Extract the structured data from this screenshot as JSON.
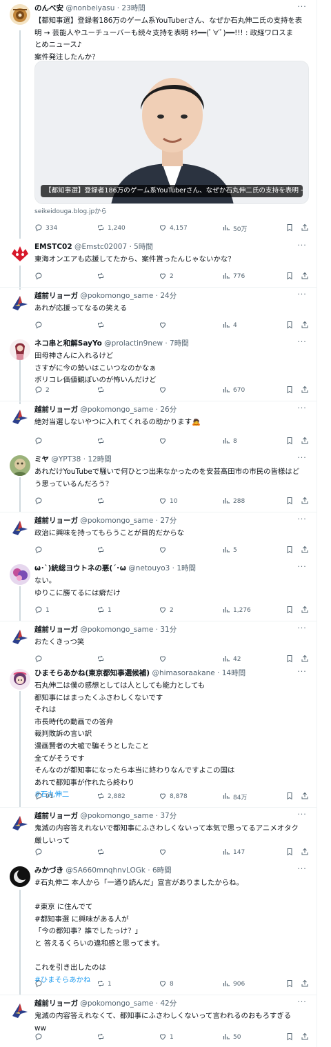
{
  "more_label": "···",
  "tweets": [
    {
      "name": "のんべ安",
      "handle": "@nonbeiyasu",
      "time": "23時間",
      "lines": [
        "【都知事選】登録者186万のゲーム系YouTuberさん、なぜか石丸伸二氏の支持を表",
        "明 → 芸能人やユーチューバーも続々支持を表明 ｷﾀ━━(ﾟ∀ﾟ)━━!!! : 政経ワロスま",
        "とめニュース♪",
        "案件発注したんか？"
      ],
      "card": {
        "caption": "【都知事選】登録者186万のゲーム系YouTuberさん、なぜか石丸伸二氏の支持を表明 →…",
        "source": "seikeidouga.blog.jpから"
      },
      "stats": {
        "reply": "334",
        "retweet": "1,240",
        "like": "4,157",
        "views": "50万"
      }
    },
    {
      "name": "EMSTC02",
      "handle": "@Emstc02007",
      "time": "5時間",
      "lines": [
        "東海オンエアも応援してたから、案件貰ったんじゃないかな？"
      ],
      "stats": {
        "reply": "",
        "retweet": "",
        "like": "2",
        "views": "776"
      }
    },
    {
      "name": "越前リョーガ",
      "handle": "@pokomongo_same",
      "time": "24分",
      "lines": [
        "あれが応援ってなるの笑える"
      ],
      "stats": {
        "reply": "",
        "retweet": "",
        "like": "",
        "views": "4"
      }
    },
    {
      "name": "ネコ串と和解SayYo",
      "handle": "@prolactin9new",
      "time": "7時間",
      "lines": [
        "田母神さんに入れるけど",
        "さすがに今の勢いはこいつなのかなぁ",
        "ポリコレ価値観ぽいのが怖いんだけど"
      ],
      "stats": {
        "reply": "2",
        "retweet": "",
        "like": "",
        "views": "670"
      }
    },
    {
      "name": "越前リョーガ",
      "handle": "@pokomongo_same",
      "time": "26分",
      "lines": [
        "絶対当選しないやつに入れてくれるの助かります🙇"
      ],
      "stats": {
        "reply": "",
        "retweet": "",
        "like": "",
        "views": "8"
      }
    },
    {
      "name": "ミヤ",
      "handle": "@YPT38",
      "time": "12時間",
      "lines": [
        "あれだけYouTubeで騒いで何ひとつ出来なかったのを安芸高田市の市民の皆様はど",
        "う思っているんだろう？"
      ],
      "stats": {
        "reply": "",
        "retweet": "",
        "like": "10",
        "views": "288"
      }
    },
    {
      "name": "越前リョーガ",
      "handle": "@pokomongo_same",
      "time": "27分",
      "lines": [
        "政治に興味を持ってもらうことが目的だからな"
      ],
      "stats": {
        "reply": "",
        "retweet": "",
        "like": "",
        "views": "5"
      }
    },
    {
      "name": "ω･`)統総ヨウトネの悪(´･ω",
      "handle": "@netouyo3",
      "time": "1時間",
      "lines": [
        "ない。",
        "ゆりこに勝てるには癖だけ"
      ],
      "stats": {
        "reply": "1",
        "retweet": "1",
        "like": "2",
        "views": "1,276"
      }
    },
    {
      "name": "越前リョーガ",
      "handle": "@pokomongo_same",
      "time": "31分",
      "lines": [
        "おたくきっつ笑"
      ],
      "stats": {
        "reply": "",
        "retweet": "",
        "like": "",
        "views": "42"
      }
    },
    {
      "name": "ひまそらあかね(東京都知事選候補)",
      "handle": "@himasoraakane",
      "time": "14時間",
      "lines": [
        "石丸伸二は僕の感想としては人としても能力としても",
        "都知事にはまったくふさわしくないです",
        "それは",
        "市長時代の動画での答弁",
        "裁判敗訴の言い訳",
        "漫画賢者の大嘘で騙そうとしたこと",
        "全てがそうです",
        "そんなのが都知事になったら本当に終わりなんですよこの国は",
        "あれで都知事が作れたら終わり",
        "#石丸伸二"
      ],
      "stats": {
        "reply": "91",
        "retweet": "2,882",
        "like": "8,878",
        "views": "84万"
      }
    },
    {
      "name": "越前リョーガ",
      "handle": "@pokomongo_same",
      "time": "37分",
      "lines": [
        "鬼滅の内容答えれないで都知事にふさわしくないって本気で思ってるアニメオタク",
        "厳しいって"
      ],
      "stats": {
        "reply": "",
        "retweet": "",
        "like": "",
        "views": "147"
      }
    },
    {
      "name": "みかづき",
      "handle": "@SA660mnqhnvLOGk",
      "time": "6時間",
      "lines": [
        "#石丸伸二 本人から「一通り読んだ」宣言がありましたからね。",
        "",
        "#東京 に住んでて",
        "#都知事選 に興味がある人が",
        "「今の都知事？誰でしたっけ？」",
        "と 答えるくらいの違和感と思ってます。",
        "",
        "これを引き出したのは",
        "#ひまそらあかね"
      ],
      "stats": {
        "reply": "",
        "retweet": "1",
        "like": "8",
        "views": "906"
      }
    },
    {
      "name": "越前リョーガ",
      "handle": "@pokomongo_same",
      "time": "42分",
      "lines": [
        "鬼滅の内容答えれなくて、都知事にふさわしくないって言われるのおもろすぎる",
        "ww"
      ],
      "stats": {
        "reply": "",
        "retweet": "",
        "like": "1",
        "views": "50"
      }
    }
  ]
}
